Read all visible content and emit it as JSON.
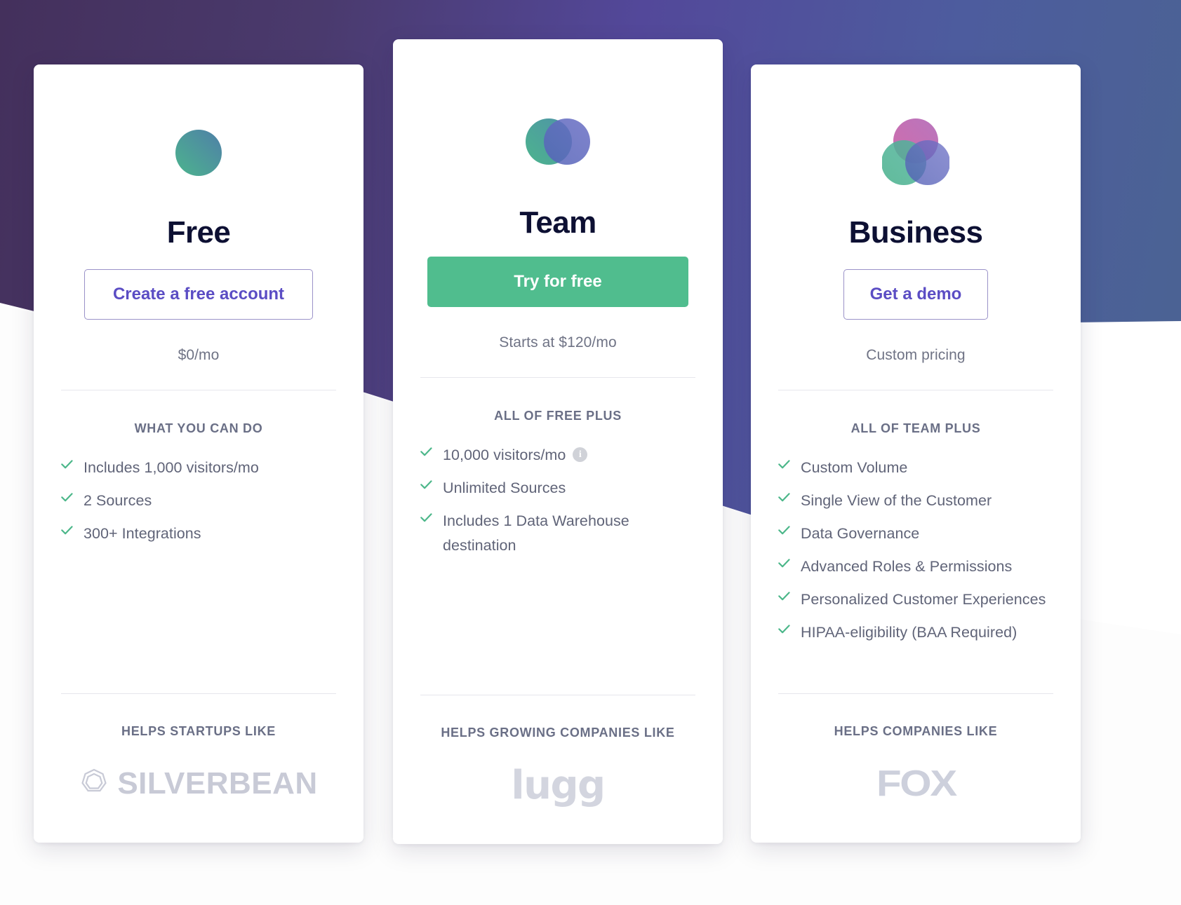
{
  "background": {
    "gradient_from": "#44305c",
    "gradient_mid": "#53489a",
    "gradient_to": "#4a6590",
    "page_color": "#fdfdfd"
  },
  "colors": {
    "heading": "#0d1033",
    "body_text": "#606478",
    "muted_label": "#6a6f86",
    "accent_purple": "#5b4dc4",
    "accent_green": "#50bd8e",
    "check_green": "#4cb78a",
    "logo_grey": "#c8cad6"
  },
  "plans": [
    {
      "id": "free",
      "icon": "single-circle-icon",
      "name": "Free",
      "cta_label": "Create a free account",
      "cta_style": "outline",
      "price_note": "$0/mo",
      "features_heading": "WHAT YOU CAN DO",
      "features": [
        {
          "text": "Includes 1,000 visitors/mo",
          "info": false
        },
        {
          "text": "2 Sources",
          "info": false
        },
        {
          "text": "300+ Integrations",
          "info": false
        }
      ],
      "helps_heading": "HELPS STARTUPS LIKE",
      "logo_name": "SILVERBEAN",
      "logo_kind": "silverbean-logo"
    },
    {
      "id": "team",
      "icon": "two-circle-venn-icon",
      "name": "Team",
      "cta_label": "Try for free",
      "cta_style": "solid",
      "price_note": "Starts at $120/mo",
      "features_heading": "ALL OF FREE PLUS",
      "features": [
        {
          "text": "10,000 visitors/mo",
          "info": true
        },
        {
          "text": "Unlimited Sources",
          "info": false
        },
        {
          "text": "Includes 1 Data Warehouse destination",
          "info": false
        }
      ],
      "helps_heading": "HELPS GROWING COMPANIES LIKE",
      "logo_name": "lugg",
      "logo_kind": "lugg-logo"
    },
    {
      "id": "business",
      "icon": "three-circle-venn-icon",
      "name": "Business",
      "cta_label": "Get a demo",
      "cta_style": "outline",
      "price_note": "Custom pricing",
      "features_heading": "ALL OF TEAM PLUS",
      "features": [
        {
          "text": "Custom Volume",
          "info": false
        },
        {
          "text": "Single View of the Customer",
          "info": false
        },
        {
          "text": "Data Governance",
          "info": false
        },
        {
          "text": "Advanced Roles & Permissions",
          "info": false
        },
        {
          "text": "Personalized Customer Experiences",
          "info": false
        },
        {
          "text": "HIPAA-eligibility (BAA Required)",
          "info": false
        }
      ],
      "helps_heading": "HELPS COMPANIES LIKE",
      "logo_name": "FOX",
      "logo_kind": "fox-logo"
    }
  ],
  "info_icon_glyph": "i"
}
